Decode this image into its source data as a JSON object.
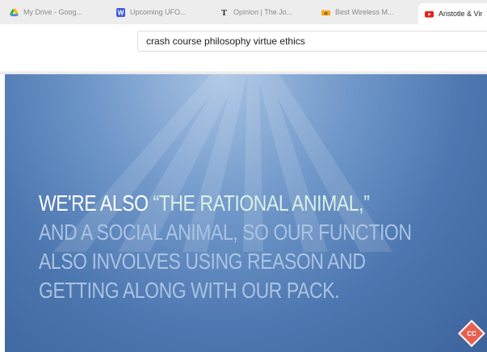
{
  "tabs": [
    {
      "label": "My Drive - Goog...",
      "icon": "google-drive-icon",
      "active": false
    },
    {
      "label": "Upcoming UFO...",
      "icon": "w-logo-icon",
      "active": false
    },
    {
      "label": "Opinion | The Jo...",
      "icon": "nyt-logo-icon",
      "active": false
    },
    {
      "label": "Best Wireless M...",
      "icon": "rtings-logo-icon",
      "active": false
    },
    {
      "label": "Aristotle & Vir",
      "icon": "youtube-icon",
      "active": true
    }
  ],
  "search": {
    "value": "crash course philosophy virtue ethics"
  },
  "video": {
    "caption_line1_part1": "WE'RE ALSO ",
    "caption_line1_part2": "“THE RATIONAL ANIMAL,”",
    "caption_line2": "AND A SOCIAL ANIMAL, SO OUR FUNCTION",
    "caption_line3": "ALSO INVOLVES USING REASON AND",
    "caption_line4": "GETTING ALONG WITH OUR PACK.",
    "logo_text": "CC"
  },
  "colors": {
    "video_bg": "#4d77b0",
    "caption_bright": "#ffffff",
    "caption_dim": "#a9c3e2",
    "youtube_red": "#e62117"
  }
}
